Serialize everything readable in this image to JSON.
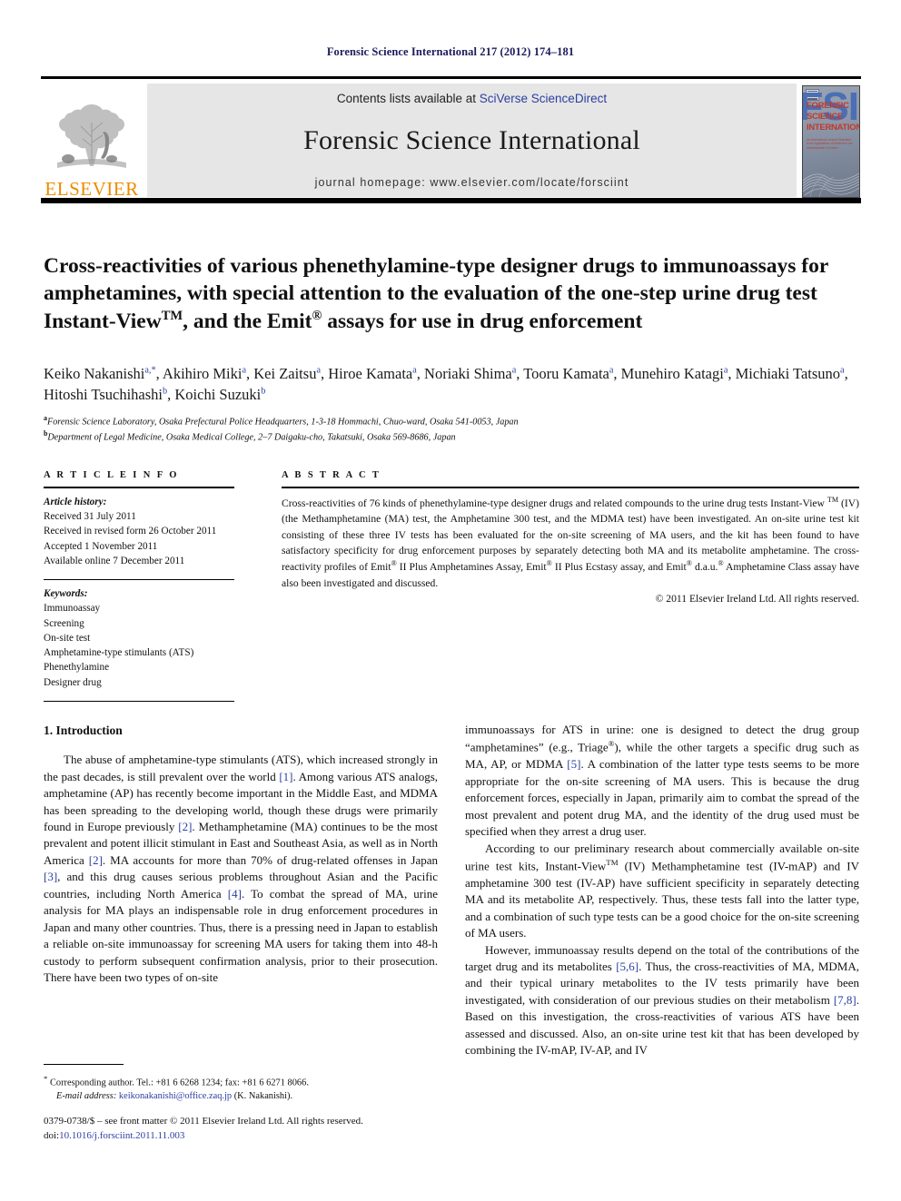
{
  "running_head": "Forensic Science International 217 (2012) 174–181",
  "masthead": {
    "contents_prefix": "Contents lists available at ",
    "contents_link": "SciVerse ScienceDirect",
    "journal_name": "Forensic Science International",
    "homepage": "journal homepage: www.elsevier.com/locate/forsciint",
    "publisher_logo_text": "ELSEVIER",
    "cover": {
      "title_lines": [
        "FORENSIC",
        "SCIENCE",
        "INTERNATIONAL"
      ],
      "initials": "FSI",
      "subtitle": "An International Journal Dedicated to the Applications of Science to the Administration of Justice"
    },
    "colors": {
      "band_bg": "#e6e6e6",
      "link": "#2b3fa0",
      "elsevier_orange": "#ED8B00",
      "cover_red": "#c0392b",
      "cover_blue": "#4a6fb5"
    }
  },
  "article": {
    "title_part1": "Cross-reactivities of various phenethylamine-type designer drugs to immunoassays for amphetamines, with special attention to the evaluation of the one-step urine drug test Instant-View",
    "title_sup1": "TM",
    "title_part2": ", and the Emit",
    "title_sup2": "®",
    "title_part3": " assays for use in drug enforcement",
    "authors_line1_segments": [
      {
        "name": "Keiko Nakanishi",
        "sup": "a,*",
        "sep": ", "
      },
      {
        "name": "Akihiro Miki",
        "sup": "a",
        "sep": ", "
      },
      {
        "name": "Kei Zaitsu",
        "sup": "a",
        "sep": ", "
      },
      {
        "name": "Hiroe Kamata",
        "sup": "a",
        "sep": ", "
      },
      {
        "name": "Noriaki Shima",
        "sup": "a",
        "sep": ", "
      },
      {
        "name": "Tooru Kamata",
        "sup": "a",
        "sep": ", "
      },
      {
        "name": "Munehiro Katagi",
        "sup": "a",
        "sep": ", "
      },
      {
        "name": "Michiaki Tatsuno",
        "sup": "a",
        "sep": ", "
      },
      {
        "name": "Hitoshi Tsuchihashi",
        "sup": "b",
        "sep": ", "
      },
      {
        "name": "Koichi Suzuki",
        "sup": "b",
        "sep": ""
      }
    ],
    "affiliations": [
      {
        "marker": "a",
        "text": "Forensic Science Laboratory, Osaka Prefectural Police Headquarters, 1-3-18 Hommachi, Chuo-ward, Osaka 541-0053, Japan"
      },
      {
        "marker": "b",
        "text": "Department of Legal Medicine, Osaka Medical College, 2–7 Daigaku-cho, Takatsuki, Osaka 569-8686, Japan"
      }
    ]
  },
  "article_info": {
    "heading": "A R T I C L E   I N F O",
    "history_label": "Article history:",
    "history": [
      "Received 31 July 2011",
      "Received in revised form 26 October 2011",
      "Accepted 1 November 2011",
      "Available online 7 December 2011"
    ],
    "keywords_label": "Keywords:",
    "keywords": [
      "Immunoassay",
      "Screening",
      "On-site test",
      "Amphetamine-type stimulants (ATS)",
      "Phenethylamine",
      "Designer drug"
    ]
  },
  "abstract": {
    "heading": "A B S T R A C T",
    "seg1": "Cross-reactivities of 76 kinds of phenethylamine-type designer drugs and related compounds to the urine drug tests Instant-View ",
    "sup1": "TM",
    "seg2": " (IV) (the Methamphetamine (MA) test, the Amphetamine 300 test, and the MDMA test) have been investigated. An on-site urine test kit consisting of these three IV tests has been evaluated for the on-site screening of MA users, and the kit has been found to have satisfactory specificity for drug enforcement purposes by separately detecting both MA and its metabolite amphetamine. The cross-reactivity profiles of Emit",
    "sup2": "®",
    "seg3": " II Plus Amphetamines Assay, Emit",
    "sup3": "®",
    "seg4": " II Plus Ecstasy assay, and Emit",
    "sup4": "®",
    "seg5": " d.a.u.",
    "sup5": "®",
    "seg6": " Amphetamine Class assay have also been investigated and discussed.",
    "copyright": "© 2011 Elsevier Ireland Ltd. All rights reserved."
  },
  "body": {
    "section_heading": "1. Introduction",
    "left_paragraph": "The abuse of amphetamine-type stimulants (ATS), which increased strongly in the past decades, is still prevalent over the world [1]. Among various ATS analogs, amphetamine (AP) has recently become important in the Middle East, and MDMA has been spreading to the developing world, though these drugs were primarily found in Europe previously [2]. Methamphetamine (MA) continues to be the most prevalent and potent illicit stimulant in East and Southeast Asia, as well as in North America [2]. MA accounts for more than 70% of drug-related offenses in Japan [3], and this drug causes serious problems throughout Asian and the Pacific countries, including North America [4]. To combat the spread of MA, urine analysis for MA plays an indispensable role in drug enforcement procedures in Japan and many other countries. Thus, there is a pressing need in Japan to establish a reliable on-site immunoassay for screening MA users for taking them into 48-h custody to perform subsequent confirmation analysis, prior to their prosecution. There have been two types of on-site",
    "right_paragraph_1_a": "immunoassays for ATS in urine: one is designed to detect the drug group “amphetamines” (e.g., Triage",
    "right_paragraph_1_sup": "®",
    "right_paragraph_1_b": "), while the other targets a specific drug such as MA, AP, or MDMA [5]. A combination of the latter type tests seems to be more appropriate for the on-site screening of MA users. This is because the drug enforcement forces, especially in Japan, primarily aim to combat the spread of the most prevalent and potent drug MA, and the identity of the drug used must be specified when they arrest a drug user.",
    "right_paragraph_2_a": "According to our preliminary research about commercially available on-site urine test kits, Instant-View",
    "right_paragraph_2_sup": "TM",
    "right_paragraph_2_b": " (IV) Methamphetamine test (IV-mAP) and IV amphetamine 300 test (IV-AP) have sufficient specificity in separately detecting MA and its metabolite AP, respectively. Thus, these tests fall into the latter type, and a combination of such type tests can be a good choice for the on-site screening of MA users.",
    "right_paragraph_3": "However, immunoassay results depend on the total of the contributions of the target drug and its metabolites [5,6]. Thus, the cross-reactivities of MA, MDMA, and their typical urinary metabolites to the IV tests primarily have been investigated, with consideration of our previous studies on their metabolism [7,8]. Based on this investigation, the cross-reactivities of various ATS have been assessed and discussed. Also, an on-site urine test kit that has been developed by combining the IV-mAP, IV-AP, and IV"
  },
  "footnotes": {
    "corresponding_marker": "*",
    "corresponding": "Corresponding author. Tel.: +81 6 6268 1234; fax: +81 6 6271 8066.",
    "email_label": "E-mail address:",
    "email": "keikonakanishi@office.zaq.jp",
    "email_owner": "(K. Nakanishi).",
    "imprint_line": "0379-0738/$ – see front matter © 2011 Elsevier Ireland Ltd. All rights reserved.",
    "doi_label": "doi:",
    "doi": "10.1016/j.forsciint.2011.11.003"
  }
}
